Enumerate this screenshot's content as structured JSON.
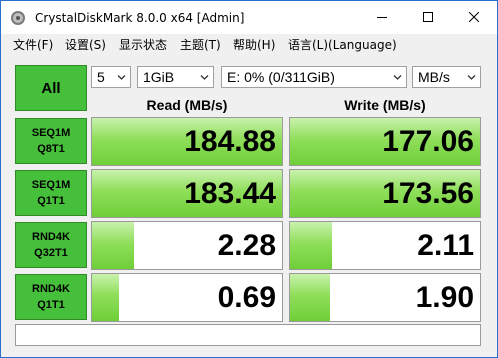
{
  "window": {
    "title": "CrystalDiskMark 8.0.0 x64 [Admin]"
  },
  "menu": [
    "文件(F)",
    "设置(S)",
    "显示状态",
    "主题(T)",
    "帮助(H)",
    "语言(L)(Language)"
  ],
  "controls": {
    "all_label": "All",
    "count": "5",
    "size": "1GiB",
    "drive": "E: 0% (0/311GiB)",
    "unit": "MB/s"
  },
  "headers": {
    "read": "Read (MB/s)",
    "write": "Write (MB/s)"
  },
  "rows": [
    {
      "line1": "SEQ1M",
      "line2": "Q8T1",
      "read": "184.88",
      "write": "177.06",
      "read_fill": 1.0,
      "write_fill": 1.0
    },
    {
      "line1": "SEQ1M",
      "line2": "Q1T1",
      "read": "183.44",
      "write": "173.56",
      "read_fill": 1.0,
      "write_fill": 1.0
    },
    {
      "line1": "RND4K",
      "line2": "Q32T1",
      "read": "2.28",
      "write": "2.11",
      "read_fill": 0.22,
      "write_fill": 0.22
    },
    {
      "line1": "RND4K",
      "line2": "Q1T1",
      "read": "0.69",
      "write": "1.90",
      "read_fill": 0.14,
      "write_fill": 0.21
    }
  ],
  "status": "",
  "colors": {
    "accent": "#46bf3a",
    "bar": "#8fde5a"
  }
}
